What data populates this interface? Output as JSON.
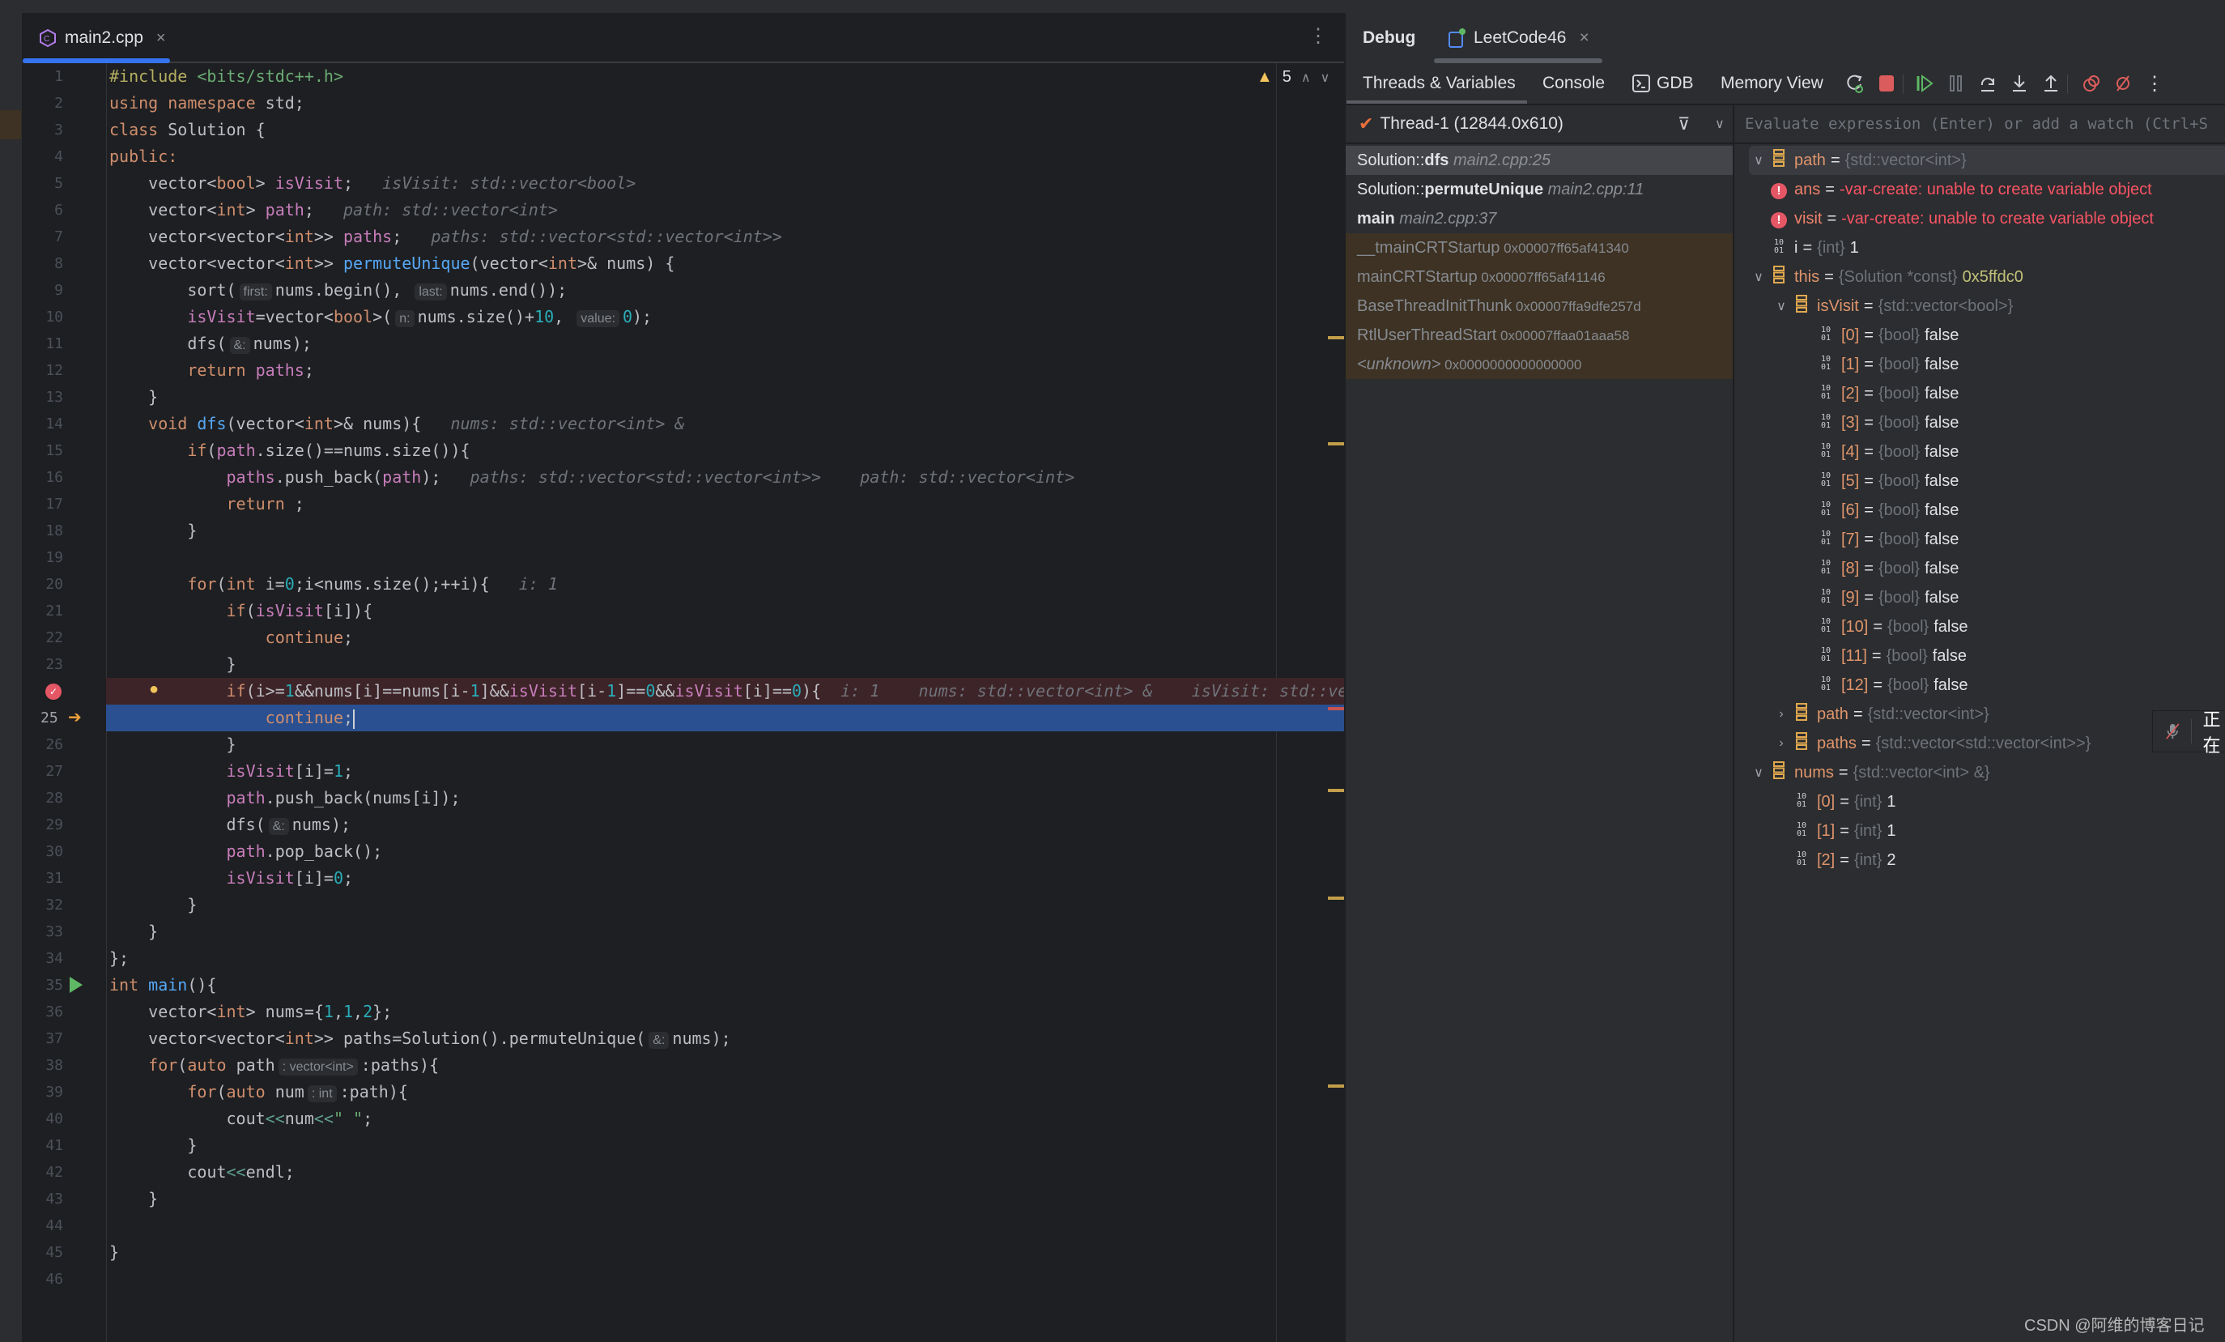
{
  "editor": {
    "tab_label": "main2.cpp",
    "tab_close": "×",
    "more": "⋮",
    "warning_count": "5",
    "current_line": "25",
    "breakpoint_line": 24,
    "exec_line": 25,
    "run_line": 35,
    "colors": {
      "breakpoint_row": "#3d2428",
      "exec_row": "#2a5091",
      "accent": "#3574f0"
    },
    "lines": [
      [
        [
          "#include ",
          "pp"
        ],
        [
          "<bits/stdc++.h>",
          "str"
        ]
      ],
      [
        [
          "using namespace ",
          "kw"
        ],
        [
          "std;",
          "id"
        ]
      ],
      [
        [
          "class ",
          "kw"
        ],
        [
          "Solution {",
          "id"
        ]
      ],
      [
        [
          "public:",
          "kw"
        ]
      ],
      [
        [
          "    vector<",
          "id"
        ],
        [
          "bool",
          "kw"
        ],
        [
          "> ",
          "id"
        ],
        [
          "isVisit",
          "fld"
        ],
        [
          ";",
          "id"
        ],
        [
          "   isVisit: std::vector<bool>",
          "inl"
        ]
      ],
      [
        [
          "    vector<",
          "id"
        ],
        [
          "int",
          "kw"
        ],
        [
          "> ",
          "id"
        ],
        [
          "path",
          "fld"
        ],
        [
          ";",
          "id"
        ],
        [
          "   path: std::vector<int>",
          "inl"
        ]
      ],
      [
        [
          "    vector<vector<",
          "id"
        ],
        [
          "int",
          "kw"
        ],
        [
          ">> ",
          "id"
        ],
        [
          "paths",
          "fld"
        ],
        [
          ";",
          "id"
        ],
        [
          "   paths: std::vector<std::vector<int>>",
          "inl"
        ]
      ],
      [
        [
          "    vector<vector<",
          "id"
        ],
        [
          "int",
          "kw"
        ],
        [
          ">> ",
          "id"
        ],
        [
          "permuteUnique",
          "fn"
        ],
        [
          "(vector<",
          "id"
        ],
        [
          "int",
          "kw"
        ],
        [
          ">& nums) {",
          "id"
        ]
      ],
      [
        [
          "        sort(",
          "id"
        ],
        [
          "first:",
          "hint"
        ],
        [
          "nums.begin(), ",
          "id"
        ],
        [
          "last:",
          "hint"
        ],
        [
          "nums.end());",
          "id"
        ]
      ],
      [
        [
          "        ",
          "id"
        ],
        [
          "isVisit",
          "fld"
        ],
        [
          "=vector<",
          "id"
        ],
        [
          "bool",
          "kw"
        ],
        [
          ">(",
          "id"
        ],
        [
          "n:",
          "hint"
        ],
        [
          "nums.size()+",
          "id"
        ],
        [
          "10",
          "num"
        ],
        [
          ", ",
          "id"
        ],
        [
          "value:",
          "hint"
        ],
        [
          "0",
          "num"
        ],
        [
          ");",
          "id"
        ]
      ],
      [
        [
          "        dfs(",
          "id"
        ],
        [
          "&:",
          "hint"
        ],
        [
          "nums);",
          "id"
        ]
      ],
      [
        [
          "        ",
          "id"
        ],
        [
          "return ",
          "kw"
        ],
        [
          "paths",
          "fld"
        ],
        [
          ";",
          "id"
        ]
      ],
      [
        [
          "    }",
          "id"
        ]
      ],
      [
        [
          "    ",
          "id"
        ],
        [
          "void ",
          "kw"
        ],
        [
          "dfs",
          "fn"
        ],
        [
          "(vector<",
          "id"
        ],
        [
          "int",
          "kw"
        ],
        [
          ">& nums){",
          "id"
        ],
        [
          "   nums: std::vector<int> &",
          "inl"
        ]
      ],
      [
        [
          "        ",
          "id"
        ],
        [
          "if",
          "kw"
        ],
        [
          "(",
          "id"
        ],
        [
          "path",
          "fld"
        ],
        [
          ".size()==nums.size()){",
          "id"
        ]
      ],
      [
        [
          "            ",
          "id"
        ],
        [
          "paths",
          "fld"
        ],
        [
          ".push_back(",
          "id"
        ],
        [
          "path",
          "fld"
        ],
        [
          ");",
          "id"
        ],
        [
          "   paths: std::vector<std::vector<int>>    path: std::vector<int>",
          "inl"
        ]
      ],
      [
        [
          "            ",
          "id"
        ],
        [
          "return ",
          "kw"
        ],
        [
          ";",
          "id"
        ]
      ],
      [
        [
          "        }",
          "id"
        ]
      ],
      [
        [
          "",
          "id"
        ]
      ],
      [
        [
          "        ",
          "id"
        ],
        [
          "for",
          "kw"
        ],
        [
          "(",
          "id"
        ],
        [
          "int ",
          "kw"
        ],
        [
          "i=",
          "id"
        ],
        [
          "0",
          "num"
        ],
        [
          ";i<nums.size();++i){",
          "id"
        ],
        [
          "   i: 1",
          "inl"
        ]
      ],
      [
        [
          "            ",
          "id"
        ],
        [
          "if",
          "kw"
        ],
        [
          "(",
          "id"
        ],
        [
          "isVisit",
          "fld"
        ],
        [
          "[i]){",
          "id"
        ]
      ],
      [
        [
          "                ",
          "id"
        ],
        [
          "continue",
          "kw"
        ],
        [
          ";",
          "id"
        ]
      ],
      [
        [
          "            }",
          "id"
        ]
      ],
      [
        [
          "            ",
          "id"
        ],
        [
          "if",
          "kw"
        ],
        [
          "(i>=",
          "id"
        ],
        [
          "1",
          "num"
        ],
        [
          "&&nums[i]==nums[i-",
          "id"
        ],
        [
          "1",
          "num"
        ],
        [
          "]&&",
          "id"
        ],
        [
          "isVisit",
          "fld"
        ],
        [
          "[i-",
          "id"
        ],
        [
          "1",
          "num"
        ],
        [
          "]==",
          "id"
        ],
        [
          "0",
          "num"
        ],
        [
          "&&",
          "id"
        ],
        [
          "isVisit",
          "fld"
        ],
        [
          "[i]==",
          "id"
        ],
        [
          "0",
          "num"
        ],
        [
          "){",
          "id"
        ],
        [
          "  i: 1    nums: std::vector<int> &    isVisit: std::ve",
          "inl"
        ]
      ],
      [
        [
          "                ",
          "id"
        ],
        [
          "continue",
          "kw"
        ],
        [
          ";",
          "id"
        ]
      ],
      [
        [
          "            }",
          "id"
        ]
      ],
      [
        [
          "            ",
          "id"
        ],
        [
          "isVisit",
          "fld"
        ],
        [
          "[i]=",
          "id"
        ],
        [
          "1",
          "num"
        ],
        [
          ";",
          "id"
        ]
      ],
      [
        [
          "            ",
          "id"
        ],
        [
          "path",
          "fld"
        ],
        [
          ".push_back(nums[i]);",
          "id"
        ]
      ],
      [
        [
          "            dfs(",
          "id"
        ],
        [
          "&:",
          "hint"
        ],
        [
          "nums);",
          "id"
        ]
      ],
      [
        [
          "            ",
          "id"
        ],
        [
          "path",
          "fld"
        ],
        [
          ".pop_back();",
          "id"
        ]
      ],
      [
        [
          "            ",
          "id"
        ],
        [
          "isVisit",
          "fld"
        ],
        [
          "[i]=",
          "id"
        ],
        [
          "0",
          "num"
        ],
        [
          ";",
          "id"
        ]
      ],
      [
        [
          "        }",
          "id"
        ]
      ],
      [
        [
          "    }",
          "id"
        ]
      ],
      [
        [
          "};",
          "id"
        ]
      ],
      [
        [
          "int ",
          "kw"
        ],
        [
          "main",
          "fn"
        ],
        [
          "(){",
          "id"
        ]
      ],
      [
        [
          "    vector<",
          "id"
        ],
        [
          "int",
          "kw"
        ],
        [
          "> nums={",
          "id"
        ],
        [
          "1",
          "num"
        ],
        [
          ",",
          "id"
        ],
        [
          "1",
          "num"
        ],
        [
          ",",
          "id"
        ],
        [
          "2",
          "num"
        ],
        [
          "};",
          "id"
        ]
      ],
      [
        [
          "    vector<vector<",
          "id"
        ],
        [
          "int",
          "kw"
        ],
        [
          ">> paths=Solution().permuteUnique(",
          "id"
        ],
        [
          "&:",
          "hint"
        ],
        [
          "nums);",
          "id"
        ]
      ],
      [
        [
          "    ",
          "id"
        ],
        [
          "for",
          "kw"
        ],
        [
          "(",
          "id"
        ],
        [
          "auto ",
          "kw"
        ],
        [
          "path",
          "id"
        ],
        [
          ": vector<int>",
          "hint"
        ],
        [
          ":paths){",
          "id"
        ]
      ],
      [
        [
          "        ",
          "id"
        ],
        [
          "for",
          "kw"
        ],
        [
          "(",
          "id"
        ],
        [
          "auto ",
          "kw"
        ],
        [
          "num",
          "id"
        ],
        [
          ": int",
          "hint"
        ],
        [
          ":path){",
          "id"
        ]
      ],
      [
        [
          "            cout",
          "id"
        ],
        [
          "<<",
          "op"
        ],
        [
          "num",
          "id"
        ],
        [
          "<<",
          "op"
        ],
        [
          "\" \"",
          "str"
        ],
        [
          ";",
          "id"
        ]
      ],
      [
        [
          "        }",
          "id"
        ]
      ],
      [
        [
          "        cout",
          "id"
        ],
        [
          "<<",
          "op"
        ],
        [
          "endl;",
          "id"
        ]
      ],
      [
        [
          "    }",
          "id"
        ]
      ],
      [
        [
          "",
          "id"
        ]
      ],
      [
        [
          "}",
          "id"
        ]
      ],
      [
        [
          "",
          "id"
        ]
      ]
    ]
  },
  "debug": {
    "tabs": [
      {
        "label": "Debug"
      },
      {
        "label": "LeetCode46",
        "close": "×"
      }
    ],
    "toolbar": {
      "threads_vars": "Threads & Variables",
      "console": "Console",
      "gdb": "GDB",
      "memory": "Memory View"
    },
    "thread": "Thread-1 (12844.0x610)",
    "eval_placeholder": "Evaluate expression (Enter) or add a watch (Ctrl+S",
    "frames": [
      {
        "fn": "Solution::dfs",
        "loc": "main2.cpp:25",
        "kind": "sel"
      },
      {
        "fn": "Solution::permuteUnique",
        "loc": "main2.cpp:11",
        "kind": "user"
      },
      {
        "fn": "main",
        "loc": "main2.cpp:37",
        "kind": "user"
      },
      {
        "fn": "__tmainCRTStartup",
        "loc": "0x00007ff65af41340",
        "kind": "lib"
      },
      {
        "fn": "mainCRTStartup",
        "loc": "0x00007ff65af41146",
        "kind": "lib"
      },
      {
        "fn": "BaseThreadInitThunk",
        "loc": "0x00007ffa9dfe257d",
        "kind": "lib"
      },
      {
        "fn": "RtlUserThreadStart",
        "loc": "0x00007ffaa01aaa58",
        "kind": "lib"
      },
      {
        "fn": "<unknown>",
        "loc": "0x0000000000000000",
        "kind": "lib"
      }
    ],
    "variables": [
      {
        "level": 0,
        "expand": "down",
        "icon": "struct",
        "name": "path",
        "type": "{std::vector<int>}",
        "value": "",
        "selected": true
      },
      {
        "level": 0,
        "expand": "",
        "icon": "error",
        "name": "ans",
        "type": "",
        "value": "-var-create: unable to create variable object",
        "vk": "err"
      },
      {
        "level": 0,
        "expand": "",
        "icon": "error",
        "name": "visit",
        "type": "",
        "value": "-var-create: unable to create variable object",
        "vk": "err"
      },
      {
        "level": 0,
        "expand": "",
        "icon": "num",
        "name": "i",
        "type": "{int}",
        "value": "1",
        "plain": true
      },
      {
        "level": 0,
        "expand": "down",
        "icon": "struct",
        "name": "this",
        "type": "{Solution *const}",
        "value": "0x5ffdc0",
        "vk": "addr"
      },
      {
        "level": 1,
        "expand": "down",
        "icon": "struct",
        "name": "isVisit",
        "type": "{std::vector<bool>}",
        "value": ""
      },
      {
        "level": 2,
        "icon": "num",
        "name": "[0]",
        "type": "{bool}",
        "value": "false"
      },
      {
        "level": 2,
        "icon": "num",
        "name": "[1]",
        "type": "{bool}",
        "value": "false"
      },
      {
        "level": 2,
        "icon": "num",
        "name": "[2]",
        "type": "{bool}",
        "value": "false"
      },
      {
        "level": 2,
        "icon": "num",
        "name": "[3]",
        "type": "{bool}",
        "value": "false"
      },
      {
        "level": 2,
        "icon": "num",
        "name": "[4]",
        "type": "{bool}",
        "value": "false"
      },
      {
        "level": 2,
        "icon": "num",
        "name": "[5]",
        "type": "{bool}",
        "value": "false"
      },
      {
        "level": 2,
        "icon": "num",
        "name": "[6]",
        "type": "{bool}",
        "value": "false"
      },
      {
        "level": 2,
        "icon": "num",
        "name": "[7]",
        "type": "{bool}",
        "value": "false"
      },
      {
        "level": 2,
        "icon": "num",
        "name": "[8]",
        "type": "{bool}",
        "value": "false"
      },
      {
        "level": 2,
        "icon": "num",
        "name": "[9]",
        "type": "{bool}",
        "value": "false"
      },
      {
        "level": 2,
        "icon": "num",
        "name": "[10]",
        "type": "{bool}",
        "value": "false"
      },
      {
        "level": 2,
        "icon": "num",
        "name": "[11]",
        "type": "{bool}",
        "value": "false"
      },
      {
        "level": 2,
        "icon": "num",
        "name": "[12]",
        "type": "{bool}",
        "value": "false"
      },
      {
        "level": 1,
        "expand": "right",
        "icon": "struct",
        "name": "path",
        "type": "{std::vector<int>}",
        "value": ""
      },
      {
        "level": 1,
        "expand": "right",
        "icon": "struct",
        "name": "paths",
        "type": "{std::vector<std::vector<int>>}",
        "value": ""
      },
      {
        "level": 0,
        "expand": "down",
        "icon": "struct",
        "name": "nums",
        "type": "{std::vector<int> &}",
        "value": ""
      },
      {
        "level": 1,
        "icon": "num",
        "name": "[0]",
        "type": "{int}",
        "value": "1"
      },
      {
        "level": 1,
        "icon": "num",
        "name": "[1]",
        "type": "{int}",
        "value": "1"
      },
      {
        "level": 1,
        "icon": "num",
        "name": "[2]",
        "type": "{int}",
        "value": "2"
      }
    ]
  },
  "overlay": {
    "text": "正在",
    "icon": "mic-muted-icon"
  },
  "watermark": "CSDN @阿维的博客日记"
}
